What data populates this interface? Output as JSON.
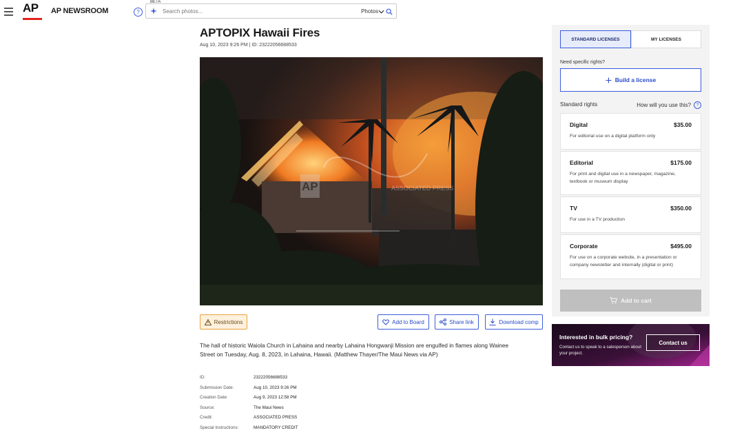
{
  "header": {
    "logo": "AP",
    "brand": "AP NEWSROOM",
    "beta_label": "BETA",
    "search_placeholder": "Search photos...",
    "search_type": "Photos"
  },
  "photo_page": {
    "title": "APTOPIX Hawaii Fires",
    "subtitle": "Aug 10, 2023 9:26 PM  |  ID: 23222056688533",
    "watermark_logo": "AP",
    "watermark_text": "ASSOCIATED PRESS",
    "actions": {
      "restrictions": "Restrictions",
      "add_to_board": "Add to Board",
      "share_link": "Share link",
      "download_comp": "Download comp"
    },
    "caption": "The hall of historic Waiola Church in Lahaina and nearby Lahaina Hongwanji Mission are engulfed in flames along Wainee Street on Tuesday, Aug. 8, 2023, in Lahaina, Hawaii. (Matthew Thayer/The Maui News via AP)",
    "metadata": [
      {
        "key": "ID:",
        "value": "23222056688533"
      },
      {
        "key": "Submission Date:",
        "value": "Aug 10, 2023 9:26 PM"
      },
      {
        "key": "Creation Date:",
        "value": "Aug 9, 2023 12:58 PM"
      },
      {
        "key": "Source:",
        "value": "The Maui News"
      },
      {
        "key": "Credit:",
        "value": "ASSOCIATED PRESS"
      },
      {
        "key": "Special Instructions:",
        "value": "MANDATORY CREDIT"
      }
    ]
  },
  "license_panel": {
    "tab_standard": "STANDARD LICENSES",
    "tab_my": "MY LICENSES",
    "need_specific": "Need specific rights?",
    "build_license": "Build a license",
    "standard_rights": "Standard rights",
    "how_use": "How will you use this?",
    "licenses": [
      {
        "name": "Digital",
        "price": "$35.00",
        "desc": "For editorial use on a digital platform only"
      },
      {
        "name": "Editorial",
        "price": "$175.00",
        "desc": "For print and digital use in a newspaper, magazine, textbook or museum display"
      },
      {
        "name": "TV",
        "price": "$350.00",
        "desc": "For use in a TV production"
      },
      {
        "name": "Corporate",
        "price": "$495.00",
        "desc": "For use on a corporate website, in a presentation or company newsletter and internally (digital or print)"
      }
    ],
    "add_to_cart": "Add to cart"
  },
  "bulk_promo": {
    "title": "Interested in bulk pricing?",
    "desc": "Contact us to speak to a salesperson about your project.",
    "button": "Contact us"
  },
  "colors": {
    "accent": "#3b5bdb",
    "ap_red": "#e2231a",
    "restrictions_bg": "#fdf1de",
    "cart_disabled": "#bfbfbf",
    "promo_bg": "#2a0c2a"
  }
}
